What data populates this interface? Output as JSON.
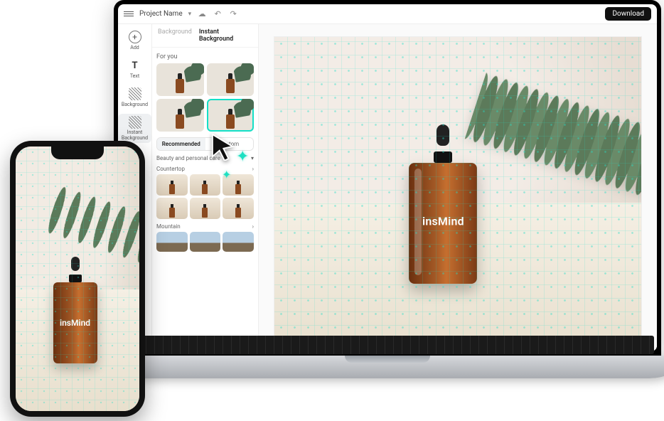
{
  "topbar": {
    "project_label": "Project Name",
    "download_label": "Download"
  },
  "rail": {
    "add": "Add",
    "text": "Text",
    "background": "Background",
    "instant": "Instant Background"
  },
  "panel": {
    "tab_background": "Background",
    "tab_instant": "Instant Background",
    "for_you": "For you",
    "seg_recommended": "Recommended",
    "seg_custom": "Custom",
    "cat_beauty": "Beauty and personal care",
    "cat_countertop": "Countertop",
    "cat_mountain": "Mountain"
  },
  "product": {
    "brand": "insMind"
  },
  "colors": {
    "accent": "#14e0c7"
  }
}
